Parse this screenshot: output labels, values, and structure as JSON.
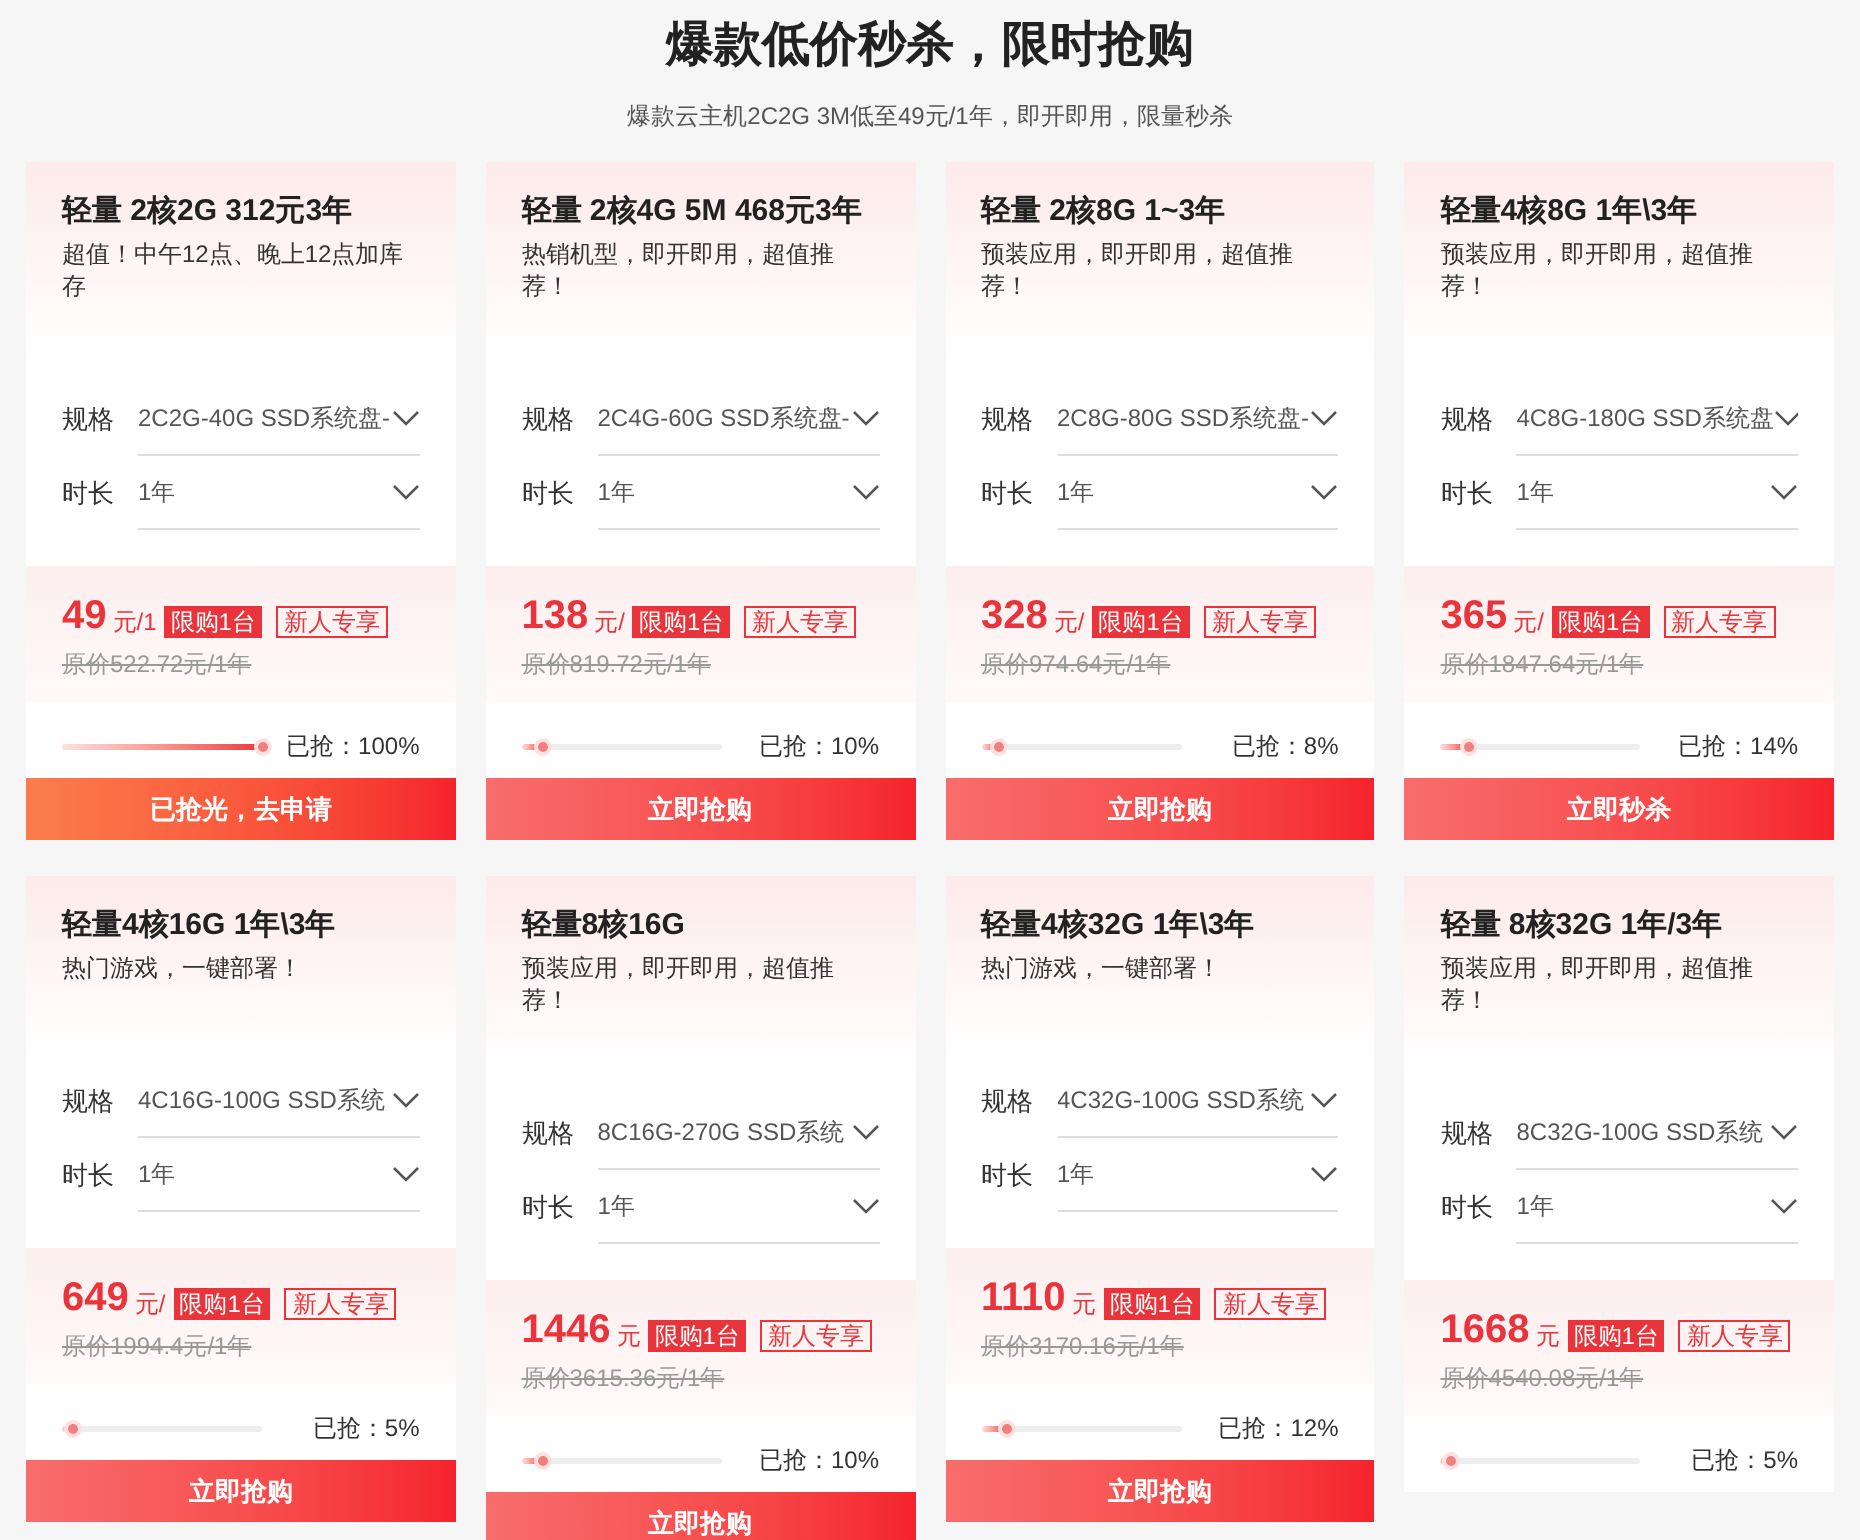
{
  "header": {
    "title": "爆款低价秒杀，限时抢购",
    "subtitle": "爆款云主机2C2G 3M低至49元/1年，即开即用，限量秒杀"
  },
  "products": [
    {
      "title": "轻量 2核2G 312元3年",
      "description": "超值！中午12点、晚上12点加库存",
      "spec": {
        "label": "规格",
        "value": "2C2G-40G SSD系统盘-"
      },
      "duration": {
        "label": "时长",
        "value": "1年"
      },
      "price": "49",
      "unit": "元/1",
      "limit_badge": "限购1台",
      "new_user_badge": "新人专享",
      "original_price": "原价522.72元/1年",
      "sold": {
        "level": 1,
        "reading": "已抢：100%"
      },
      "button": {
        "kind": "sold_out",
        "label": "已抢光，去申请"
      }
    },
    {
      "title": "轻量 2核4G 5M 468元3年",
      "description": "热销机型，即开即用，超值推荐！",
      "spec": {
        "label": "规格",
        "value": "2C4G-60G SSD系统盘-"
      },
      "duration": {
        "label": "时长",
        "value": "1年"
      },
      "price": "138",
      "unit": "元/",
      "limit_badge": "限购1台",
      "new_user_badge": "新人专享",
      "original_price": "原价819.72元/1年",
      "sold": {
        "level": 0.1,
        "reading": "已抢：10%"
      },
      "button": {
        "kind": "buy",
        "label": "立即抢购"
      }
    },
    {
      "title": "轻量 2核8G 1~3年",
      "description": "预装应用，即开即用，超值推荐！",
      "spec": {
        "label": "规格",
        "value": "2C8G-80G SSD系统盘-"
      },
      "duration": {
        "label": "时长",
        "value": "1年"
      },
      "price": "328",
      "unit": "元/",
      "limit_badge": "限购1台",
      "new_user_badge": "新人专享",
      "original_price": "原价974.64元/1年",
      "sold": {
        "level": 0.08,
        "reading": "已抢：8%"
      },
      "button": {
        "kind": "buy",
        "label": "立即抢购"
      }
    },
    {
      "title": "轻量4核8G 1年\\3年",
      "description": "预装应用，即开即用，超值推荐！",
      "spec": {
        "label": "规格",
        "value": "4C8G-180G SSD系统盘"
      },
      "duration": {
        "label": "时长",
        "value": "1年"
      },
      "price": "365",
      "unit": "元/",
      "limit_badge": "限购1台",
      "new_user_badge": "新人专享",
      "original_price": "原价1847.64元/1年",
      "sold": {
        "level": 0.14,
        "reading": "已抢：14%"
      },
      "button": {
        "kind": "buy",
        "label": "立即秒杀"
      }
    },
    {
      "title": "轻量4核16G 1年\\3年",
      "description": "热门游戏，一键部署！",
      "spec": {
        "label": "规格",
        "value": "4C16G-100G SSD系统"
      },
      "duration": {
        "label": "时长",
        "value": "1年"
      },
      "price": "649",
      "unit": "元/",
      "limit_badge": "限购1台",
      "new_user_badge": "新人专享",
      "original_price": "原价1994.4元/1年",
      "sold": {
        "level": 0.05,
        "reading": "已抢：5%"
      },
      "button": {
        "kind": "buy",
        "label": "立即抢购"
      }
    },
    {
      "title": "轻量8核16G",
      "description": "预装应用，即开即用，超值推荐！",
      "spec": {
        "label": "规格",
        "value": "8C16G-270G SSD系统"
      },
      "duration": {
        "label": "时长",
        "value": "1年"
      },
      "price": "1446",
      "unit": "元",
      "limit_badge": "限购1台",
      "new_user_badge": "新人专享",
      "original_price": "原价3615.36元/1年",
      "sold": {
        "level": 0.1,
        "reading": "已抢：10%"
      },
      "button": {
        "kind": "buy",
        "label": "立即抢购"
      }
    },
    {
      "title": "轻量4核32G 1年\\3年",
      "description": "热门游戏，一键部署！",
      "spec": {
        "label": "规格",
        "value": "4C32G-100G SSD系统"
      },
      "duration": {
        "label": "时长",
        "value": "1年"
      },
      "price": "1110",
      "unit": "元",
      "limit_badge": "限购1台",
      "new_user_badge": "新人专享",
      "original_price": "原价3170.16元/1年",
      "sold": {
        "level": 0.12,
        "reading": "已抢：12%"
      },
      "button": {
        "kind": "buy",
        "label": "立即抢购"
      }
    },
    {
      "title": "轻量 8核32G 1年/3年",
      "description": "预装应用，即开即用，超值推荐！",
      "spec": {
        "label": "规格",
        "value": "8C32G-100G SSD系统"
      },
      "duration": {
        "label": "时长",
        "value": "1年"
      },
      "price": "1668",
      "unit": "元",
      "limit_badge": "限购1台",
      "new_user_badge": "新人专享",
      "original_price": "原价4540.08元/1年",
      "sold": {
        "level": 0.05,
        "reading": "已抢：5%"
      }
    }
  ]
}
